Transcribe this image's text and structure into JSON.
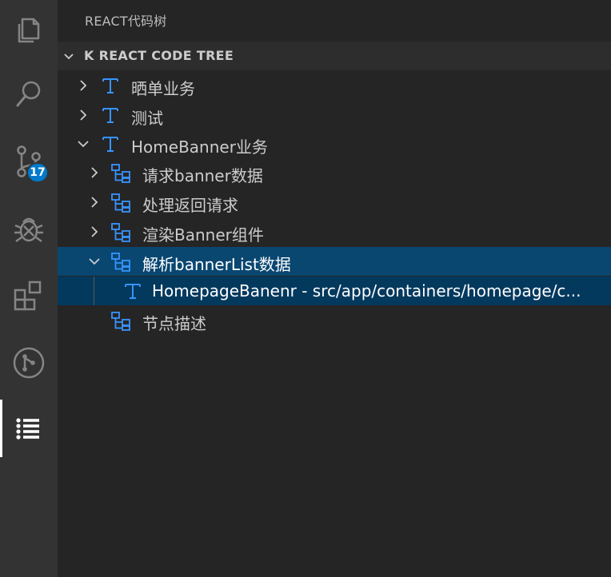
{
  "activity_bar": {
    "items": [
      {
        "name": "explorer",
        "icon": "files-icon"
      },
      {
        "name": "search",
        "icon": "search-icon"
      },
      {
        "name": "source-control",
        "icon": "source-control-icon",
        "badge": "17"
      },
      {
        "name": "debug",
        "icon": "debug-icon"
      },
      {
        "name": "extensions",
        "icon": "extensions-icon"
      },
      {
        "name": "git-graph",
        "icon": "git-graph-icon"
      },
      {
        "name": "react-code-tree",
        "icon": "list-icon",
        "active": true
      }
    ]
  },
  "sidebar": {
    "title": "REACT代码树",
    "section_title": "K REACT CODE TREE",
    "tree": [
      {
        "label": "晒单业务",
        "type": "text-node",
        "expanded": false
      },
      {
        "label": "测试",
        "type": "text-node",
        "expanded": false
      },
      {
        "label": "HomeBanner业务",
        "type": "text-node",
        "expanded": true
      },
      {
        "label": "请求banner数据",
        "type": "flow-node",
        "expanded": false
      },
      {
        "label": "处理返回请求",
        "type": "flow-node",
        "expanded": false
      },
      {
        "label": "渲染Banner组件",
        "type": "flow-node",
        "expanded": false
      },
      {
        "label": "解析bannerList数据",
        "type": "flow-node",
        "expanded": true,
        "selected": true
      },
      {
        "label": "HomepageBanenr - src/app/containers/homepage/c...",
        "type": "text-node"
      },
      {
        "label": "节点描述",
        "type": "flow-node"
      }
    ]
  },
  "colors": {
    "activity_bar_bg": "#333333",
    "sidebar_bg": "#252526",
    "selection_bg": "#094771",
    "badge_bg": "#007acc",
    "icon_blue": "#3794ff"
  }
}
